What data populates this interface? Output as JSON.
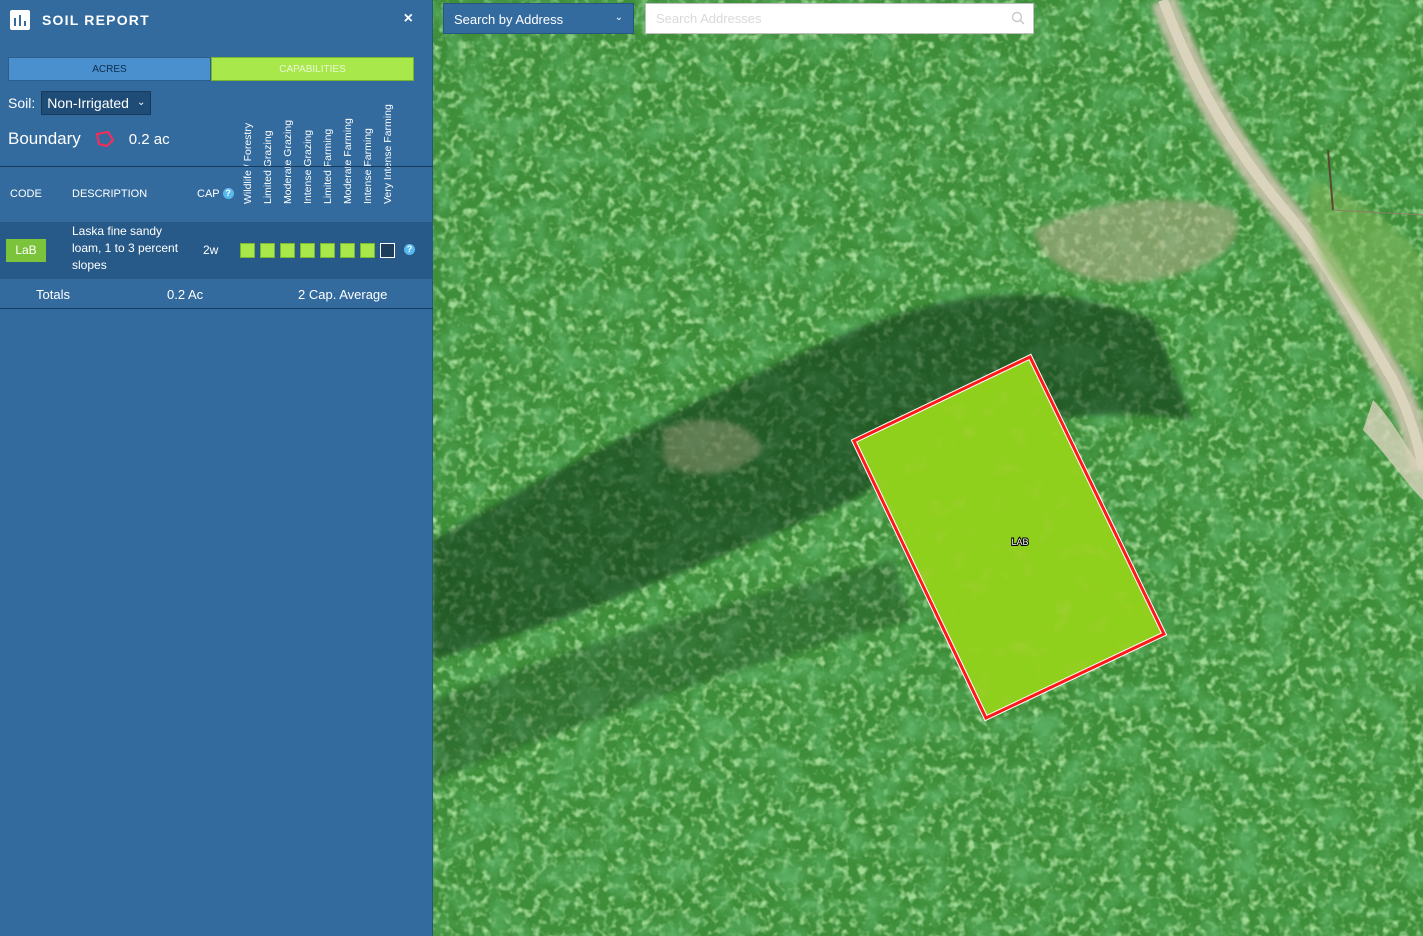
{
  "report": {
    "title": "SOIL REPORT",
    "close_label": "×",
    "tabs": [
      {
        "label": "ACRES",
        "active": false
      },
      {
        "label": "CAPABILITIES",
        "active": true
      }
    ],
    "soil_label": "Soil:",
    "soil_selected": "Non-Irrigated",
    "boundary_label": "Boundary",
    "boundary_acres": "0.2 ac",
    "capability_headers": [
      "Wildlife / Forestry",
      "Limited Grazing",
      "Moderate Grazing",
      "Intense Grazing",
      "Limited Farming",
      "Moderate Farming",
      "Intense Farming",
      "Very Intense Farming"
    ],
    "columns": {
      "code": "CODE",
      "description": "DESCRIPTION",
      "cap": "CAP",
      "help": "?"
    },
    "rows": [
      {
        "code": "LaB",
        "description": "Laska fine sandy loam, 1 to 3 percent slopes",
        "cap": "2w",
        "capability_flags": [
          true,
          true,
          true,
          true,
          true,
          true,
          true,
          false
        ],
        "help": "?"
      }
    ],
    "totals": {
      "label": "Totals",
      "acres": "0.2 Ac",
      "average": "2 Cap. Average"
    }
  },
  "map": {
    "search_type": "Search by Address",
    "search_placeholder": "Search Addresses",
    "parcel_label": "LAB",
    "colors": {
      "parcel_fill": "#8fd01c",
      "parcel_outline": "#ff1a1a",
      "panel": "#336b9f",
      "capability_on": "#a8e84a"
    }
  }
}
